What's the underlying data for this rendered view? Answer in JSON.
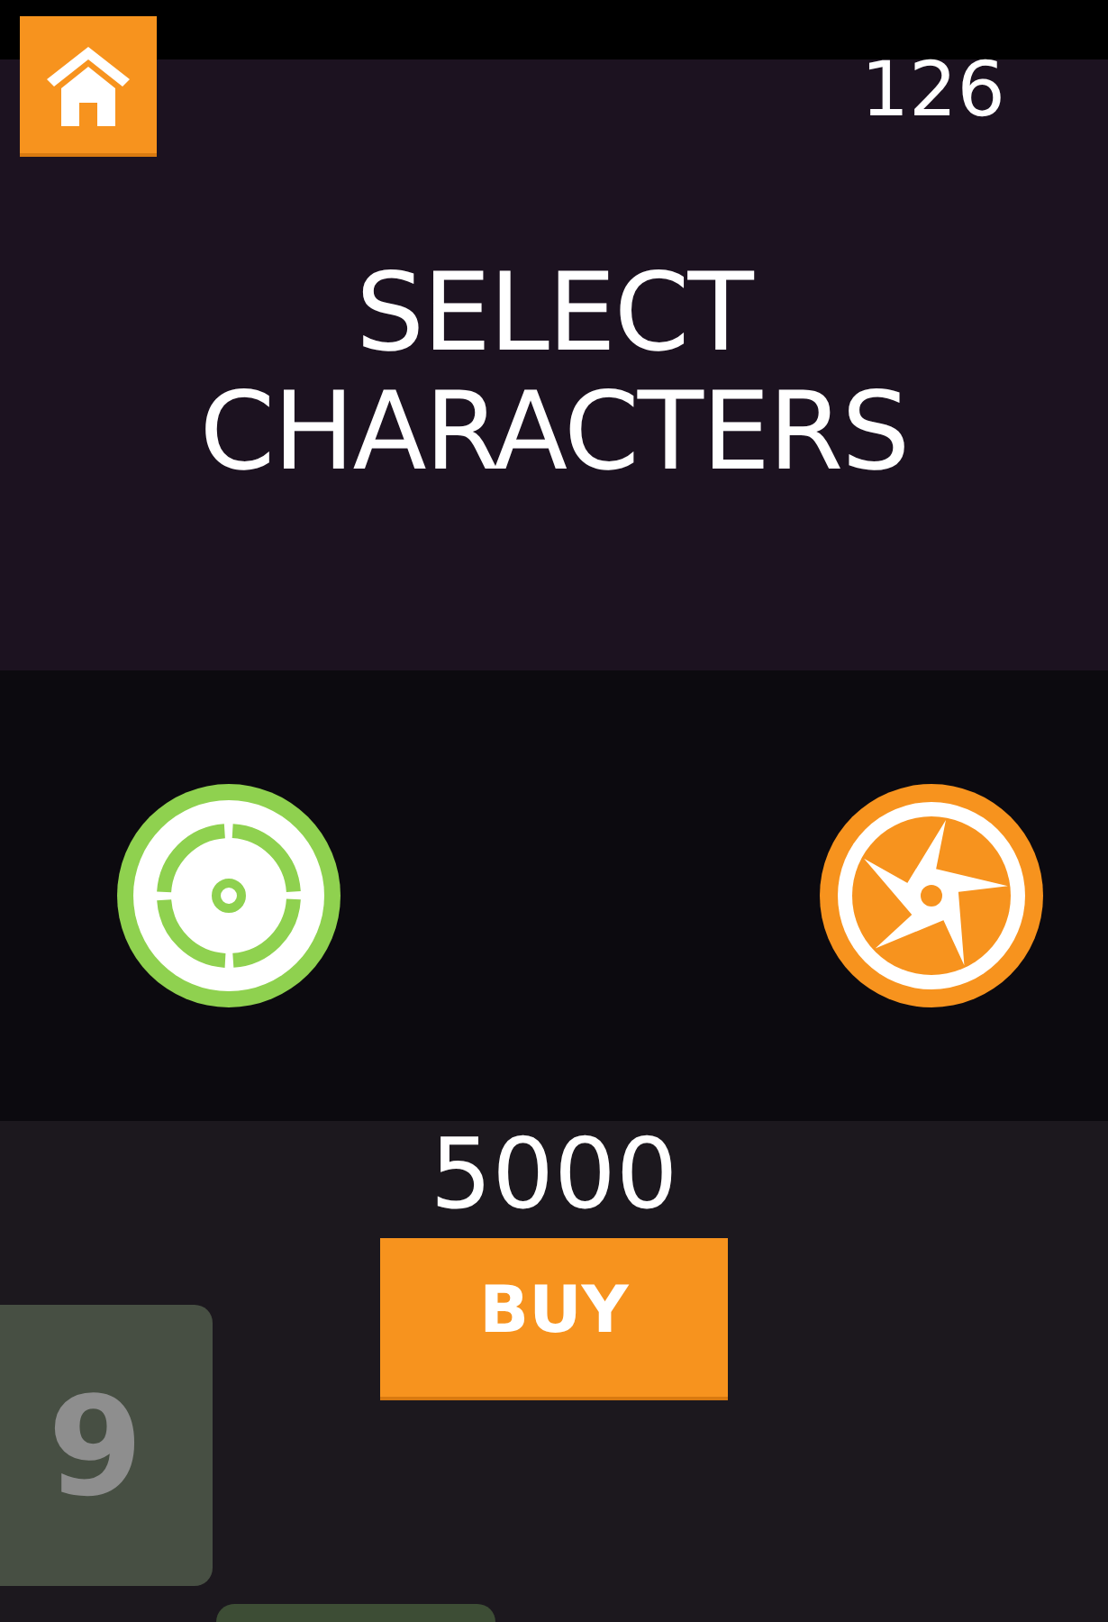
{
  "score": "126",
  "title": [
    "SELECT",
    "CHARACTERS"
  ],
  "characters": [
    {
      "kind": "target",
      "color": "#8fd14f"
    },
    {
      "kind": "shuriken",
      "color": "#f7931e"
    }
  ],
  "price": "5000",
  "buy_button": "BUY",
  "board_tiles": [
    {
      "label": "9",
      "kind": "number"
    },
    {
      "kind": "blank"
    }
  ]
}
